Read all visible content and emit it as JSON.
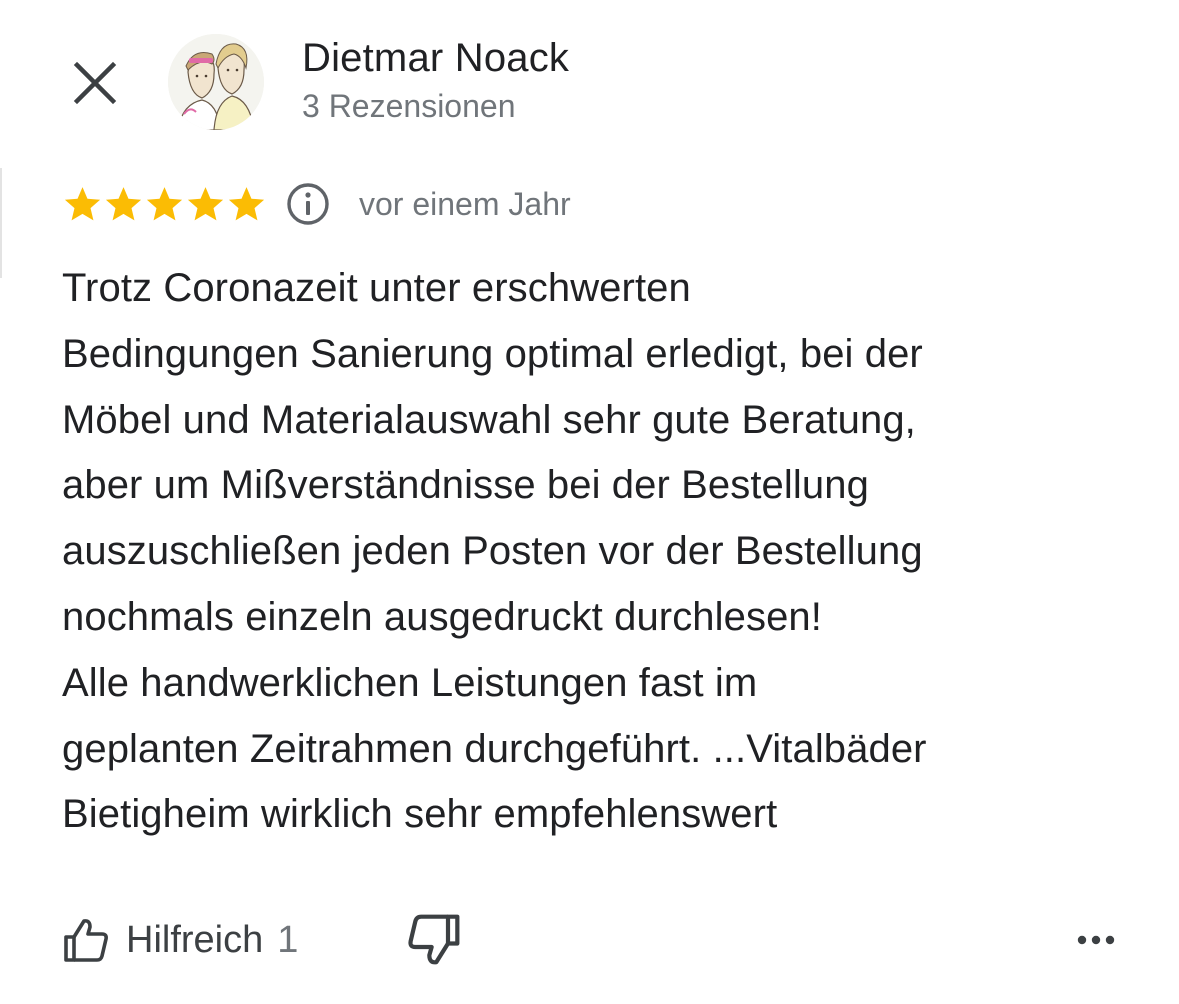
{
  "review": {
    "author_name": "Dietmar Noack",
    "review_count": "3 Rezensionen",
    "rating": 5,
    "rating_max": 5,
    "date": "vor einem Jahr",
    "text_lines": [
      "Trotz Coronazeit unter erschwerten",
      "Bedingungen Sanierung optimal erledigt, bei der",
      "Möbel und Materialauswahl sehr gute Beratung,",
      "aber um Mißverständnisse bei der Bestellung",
      "auszuschließen jeden Posten vor der Bestellung",
      "nochmals einzeln ausgedruckt durchlesen!",
      "Alle handwerklichen Leistungen fast im",
      "geplanten Zeitrahmen durchgeführt. ...Vitalbäder",
      "Bietigheim wirklich sehr empfehlenswert"
    ]
  },
  "actions": {
    "helpful_label": "Hilfreich",
    "helpful_count": "1"
  },
  "icons": {
    "close": "close-icon",
    "star": "star-icon",
    "info": "info-icon",
    "thumbs_up": "thumbs-up-icon",
    "thumbs_down": "thumbs-down-icon",
    "more": "more-horizontal-icon"
  },
  "colors": {
    "star": "#fbbc04",
    "primary_text": "#202124",
    "secondary_text": "#70757a",
    "icon": "#3c4043"
  }
}
